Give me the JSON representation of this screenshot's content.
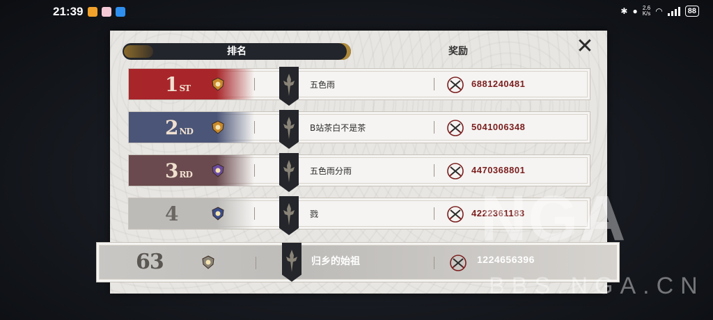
{
  "status_bar": {
    "time": "21:39",
    "net_speed_value": "2.6",
    "net_speed_unit": "K/s",
    "battery": "88"
  },
  "tabs": {
    "ranking": "排名",
    "rewards": "奖励"
  },
  "close_icon": "close-x",
  "rows": [
    {
      "rank": "1",
      "suffix": "ST",
      "name": "五色雨",
      "score": "6881240481",
      "color": "#a8262a"
    },
    {
      "rank": "2",
      "suffix": "ND",
      "name": "B站茶白不是茶",
      "score": "5041006348",
      "color": "#4b5577"
    },
    {
      "rank": "3",
      "suffix": "RD",
      "name": "五色雨分雨",
      "score": "4470368801",
      "color": "#6a4a4e"
    },
    {
      "rank": "4",
      "suffix": "",
      "name": "戮",
      "score": "4222361183",
      "color": "#bdbbb8"
    }
  ],
  "self_row": {
    "rank": "63",
    "name": "归乡的始祖",
    "score": "1224656396"
  },
  "watermark": {
    "logo": "NGA",
    "url": "BBS.NGA.CN"
  }
}
